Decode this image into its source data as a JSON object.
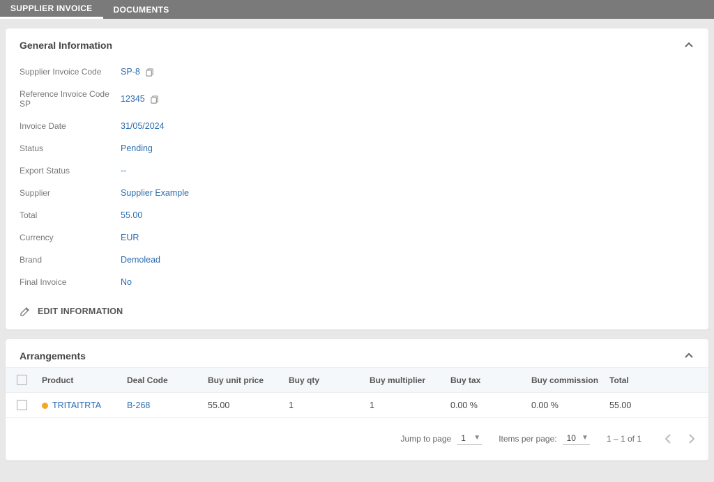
{
  "tabs": {
    "supplier_invoice": "SUPPLIER INVOICE",
    "documents": "DOCUMENTS"
  },
  "general": {
    "title": "General Information",
    "rows": {
      "supplier_invoice_code": {
        "label": "Supplier Invoice Code",
        "value": "SP-8"
      },
      "reference_invoice_code": {
        "label": "Reference Invoice Code SP",
        "value": "12345"
      },
      "invoice_date": {
        "label": "Invoice Date",
        "value": "31/05/2024"
      },
      "status": {
        "label": "Status",
        "value": "Pending"
      },
      "export_status": {
        "label": "Export Status",
        "value": "--"
      },
      "supplier": {
        "label": "Supplier",
        "value": "Supplier Example"
      },
      "total": {
        "label": "Total",
        "value": "55.00"
      },
      "currency": {
        "label": "Currency",
        "value": "EUR"
      },
      "brand": {
        "label": "Brand",
        "value": "Demolead"
      },
      "final_invoice": {
        "label": "Final Invoice",
        "value": "No"
      }
    },
    "edit_label": "EDIT INFORMATION"
  },
  "arrangements": {
    "title": "Arrangements",
    "headers": {
      "product": "Product",
      "deal_code": "Deal Code",
      "buy_unit_price": "Buy unit price",
      "buy_qty": "Buy qty",
      "buy_multiplier": "Buy multiplier",
      "buy_tax": "Buy tax",
      "buy_commission": "Buy commission",
      "total": "Total"
    },
    "rows": [
      {
        "product": "TRITAITRTA",
        "deal_code": "B-268",
        "buy_unit_price": "55.00",
        "buy_qty": "1",
        "buy_multiplier": "1",
        "buy_tax": "0.00 %",
        "buy_commission": "0.00 %",
        "total": "55.00"
      }
    ],
    "pagination": {
      "jump_label": "Jump to page",
      "jump_value": "1",
      "per_page_label": "Items per page:",
      "per_page_value": "10",
      "range": "1 – 1 of 1"
    }
  }
}
